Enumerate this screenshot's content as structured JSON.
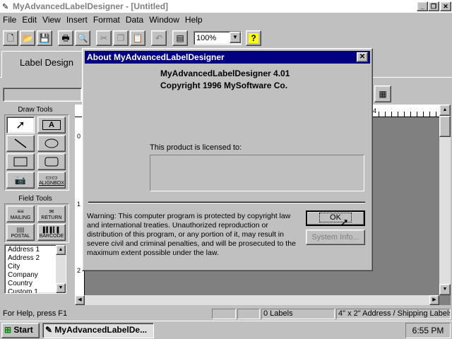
{
  "window": {
    "title": "MyAdvancedLabelDesigner - [Untitled]",
    "controls": {
      "minimize": "_",
      "restore": "❐",
      "close": "✕"
    }
  },
  "menu": [
    "File",
    "Edit",
    "View",
    "Insert",
    "Format",
    "Data",
    "Window",
    "Help"
  ],
  "toolbar": {
    "zoom_value": "100%",
    "help_glyph": "?"
  },
  "tabs": {
    "label_design": "Label Design"
  },
  "left_panel": {
    "draw_tools_title": "Draw Tools",
    "align_label": "ALIGNBOX",
    "field_tools_title": "Field Tools",
    "field_buttons": {
      "mailing": "MAILING",
      "return": "RETURN",
      "postal": "POSTAL",
      "barcode": "BARCODE"
    },
    "field_list": [
      "Address 1",
      "Address 2",
      "City",
      "Company",
      "Country",
      "Custom 1"
    ]
  },
  "ruler": {
    "mark_4": "4",
    "left_0": "0",
    "left_1": "1",
    "left_2": "2"
  },
  "dialog": {
    "title": "About MyAdvancedLabelDesigner",
    "product_line": "MyAdvancedLabelDesigner  4.01",
    "copyright_line": "Copyright 1996  MySoftware Co.",
    "licensed_to_label": "This product is licensed to:",
    "licensed_to_value": "",
    "warning": "Warning: This computer program is protected by copyright law and international treaties. Unauthorized reproduction or distribution of this program, or any portion of it, may result in severe civil and criminal penalties, and will be prosecuted to the maximum extent possible under the law.",
    "ok_label": "OK",
    "sysinfo_label": "System Info..."
  },
  "status": {
    "help_text": "For Help, press F1",
    "labels_count": "0 Labels",
    "label_type": "4\" x 2\" Address / Shipping Labels"
  },
  "taskbar": {
    "start_label": "Start",
    "task_label": "MyAdvancedLabelDe...",
    "clock": "6:55 PM"
  }
}
